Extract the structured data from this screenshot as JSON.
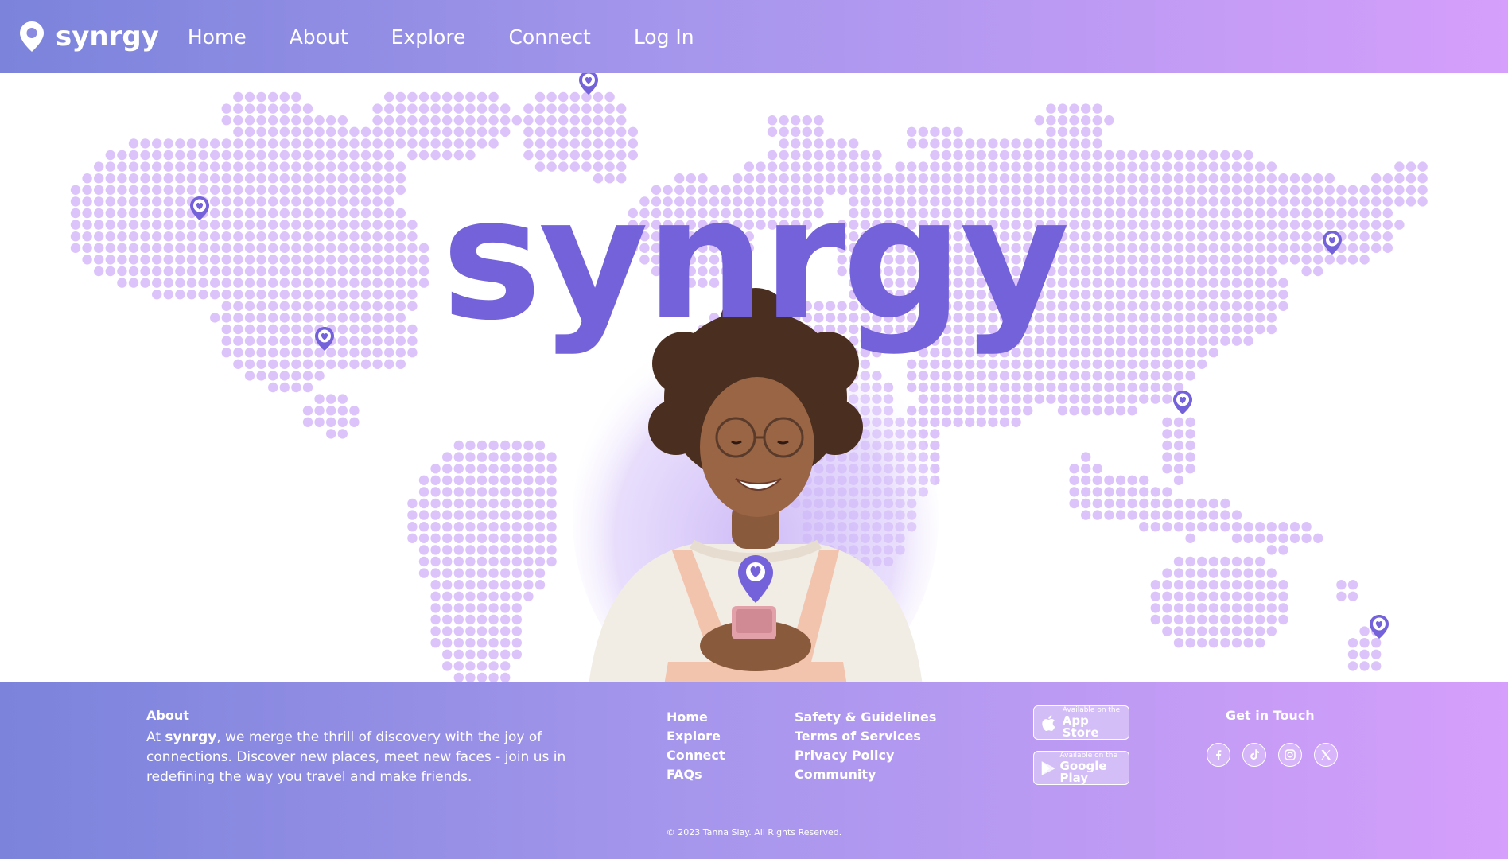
{
  "header": {
    "logo_text": "synrgy",
    "nav": [
      {
        "label": "Home"
      },
      {
        "label": "About"
      },
      {
        "label": "Explore"
      },
      {
        "label": "Connect"
      },
      {
        "label": "Log In"
      }
    ]
  },
  "hero": {
    "title": "synrgy",
    "map_dot_color": "#dcc4fb",
    "accent_color": "#7462da",
    "icons": {
      "pin": "heart-location-pin-icon"
    }
  },
  "footer": {
    "about_heading": "About",
    "about_prefix": "At ",
    "about_brand": "synrgy",
    "about_text": ", we merge the thrill of discovery with the joy of connections. Discover new places, meet new faces - join us in redefining the way you travel and make friends.",
    "links_col1": [
      {
        "label": "Home"
      },
      {
        "label": "Explore"
      },
      {
        "label": "Connect"
      },
      {
        "label": "FAQs"
      }
    ],
    "links_col2": [
      {
        "label": "Safety & Guidelines"
      },
      {
        "label": "Terms of Services"
      },
      {
        "label": "Privacy Policy"
      },
      {
        "label": "Community"
      }
    ],
    "stores": [
      {
        "small": "Available on the",
        "big": "App Store",
        "icon": "apple-icon"
      },
      {
        "small": "Available on the",
        "big": "Google Play",
        "icon": "google-play-icon"
      }
    ],
    "contact_heading": "Get in Touch",
    "socials": [
      {
        "icon": "facebook-icon"
      },
      {
        "icon": "tiktok-icon"
      },
      {
        "icon": "instagram-icon"
      },
      {
        "icon": "x-icon"
      }
    ],
    "copyright": "© 2023 Tanna Slay. All Rights Reserved."
  },
  "colors": {
    "gradient_start": "#7b83db",
    "gradient_end": "#d59ffb",
    "brand_purple": "#7462da"
  }
}
